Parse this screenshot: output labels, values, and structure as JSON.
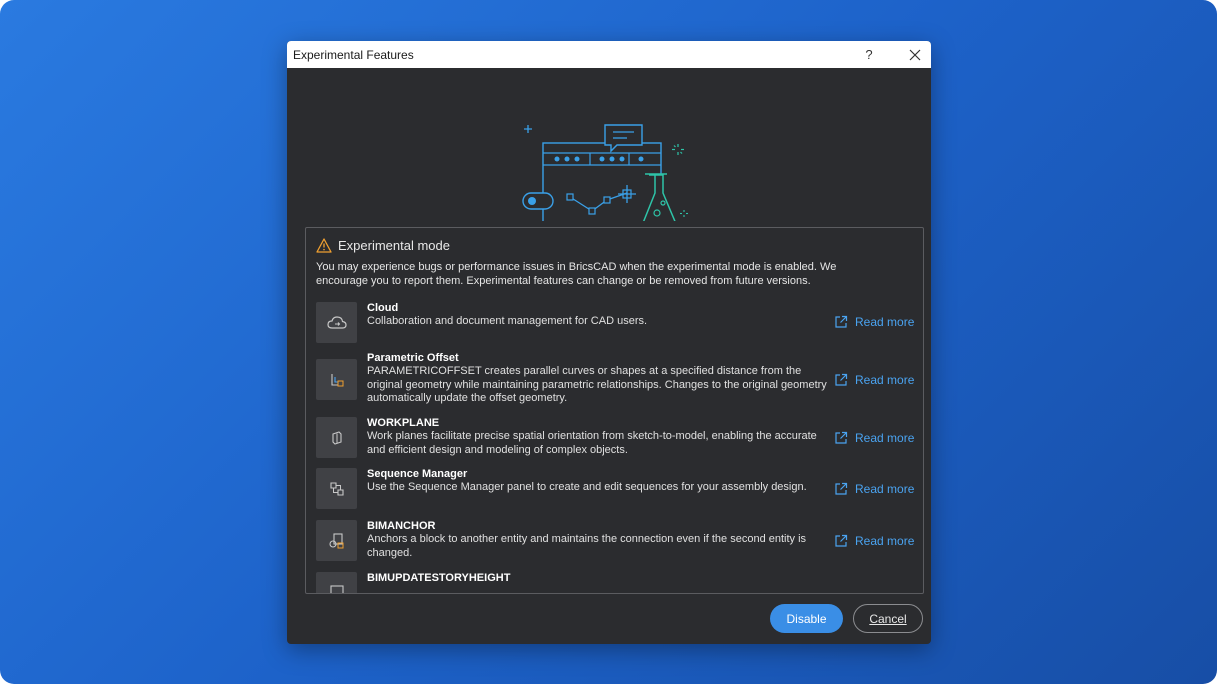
{
  "dialog": {
    "title": "Experimental Features",
    "help_label": "?",
    "close_label": "✕"
  },
  "warning": {
    "title": "Experimental mode",
    "description": "You may experience bugs or performance issues in BricsCAD when the experimental mode is enabled. We encourage you to report them. Experimental features can change or be removed from future versions."
  },
  "features": [
    {
      "name": "Cloud",
      "description": "Collaboration and document management for CAD users.",
      "link": "Read more",
      "icon": "cloud-icon"
    },
    {
      "name": "Parametric Offset",
      "description": "PARAMETRICOFFSET creates parallel curves or shapes at a specified distance from the original geometry while maintaining parametric relationships. Changes to the original geometry automatically update the offset geometry.",
      "link": "Read more",
      "icon": "parametric-offset-icon"
    },
    {
      "name": "WORKPLANE",
      "description": "Work planes facilitate precise spatial orientation from sketch-to-model, enabling the accurate and efficient design and modeling of complex objects.",
      "link": "Read more",
      "icon": "workplane-icon"
    },
    {
      "name": "Sequence Manager",
      "description": "Use the Sequence Manager panel to create and edit sequences for your assembly design.",
      "link": "Read more",
      "icon": "sequence-manager-icon"
    },
    {
      "name": "BIMANCHOR",
      "description": "Anchors a block to another entity and maintains the connection even if the second entity is changed.",
      "link": "Read more",
      "icon": "bimanchor-icon"
    },
    {
      "name": "BIMUPDATESTORYHEIGHT",
      "description": "",
      "link": "",
      "icon": "bim-story-icon"
    }
  ],
  "buttons": {
    "disable": "Disable",
    "cancel": "Cancel"
  },
  "colors": {
    "accent": "#3a8ee6",
    "link": "#4aa3f0",
    "warning": "#f0a030",
    "illustration_blue": "#3aa0e8",
    "illustration_teal": "#2ec4a8",
    "dialog_bg": "#2b2c2f"
  }
}
